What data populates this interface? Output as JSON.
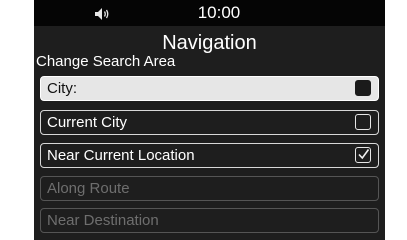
{
  "status": {
    "time": "10:00",
    "volume_icon": "speaker-volume-icon"
  },
  "screen": {
    "title": "Navigation",
    "subtitle": "Change Search Area"
  },
  "options": [
    {
      "label": "City:",
      "state": "selected",
      "check": "filled"
    },
    {
      "label": "Current City",
      "state": "normal",
      "check": "unchecked"
    },
    {
      "label": "Near Current Location",
      "state": "normal",
      "check": "checked"
    },
    {
      "label": "Along Route",
      "state": "disabled",
      "check": "none"
    },
    {
      "label": "Near Destination",
      "state": "disabled",
      "check": "none"
    }
  ],
  "colors": {
    "background": "#1e1e1e",
    "status_bar": "#050505",
    "highlight": "#e6e6e6",
    "disabled_text": "#6e6e6e"
  }
}
